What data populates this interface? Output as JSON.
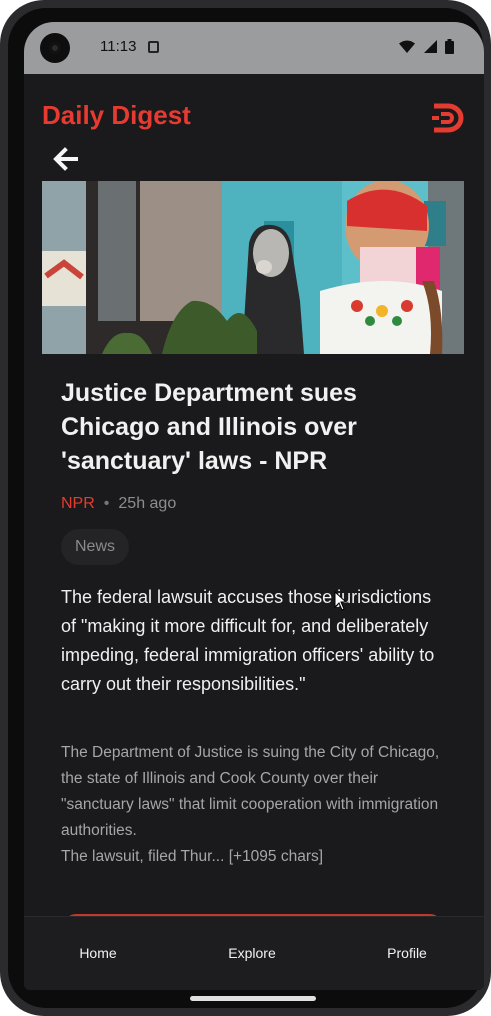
{
  "status_bar": {
    "time": "11:13",
    "icons": [
      "sim-icon",
      "wifi-icon",
      "signal-icon",
      "battery-icon"
    ]
  },
  "header": {
    "app_title": "Daily Digest",
    "logo_icon": "daily-digest-logo-icon",
    "back_icon": "back-arrow-icon"
  },
  "article": {
    "title": "Justice Department sues Chicago and Illinois over 'sanctuary' laws - NPR",
    "source": "NPR",
    "separator": "•",
    "age": "25h ago",
    "category": "News",
    "lede": "The federal lawsuit accuses those jurisdictions of \"making it more difficult for, and deliberately impeding, federal immigration officers' ability to carry out their responsibilities.\"",
    "body_line1": "The Department of Justice is suing the City of Chicago, the state of Illinois and Cook County over their \"sanctuary laws\" that limit cooperation with immigration authorities.",
    "body_line2": "The lawsuit, filed Thur... [+1095 chars]"
  },
  "bottom_nav": {
    "items": [
      {
        "label": "Home"
      },
      {
        "label": "Explore"
      },
      {
        "label": "Profile"
      }
    ]
  },
  "colors": {
    "accent": "#e63b31",
    "background": "#1a1a1c",
    "status_bar": "#9b9c9e"
  }
}
